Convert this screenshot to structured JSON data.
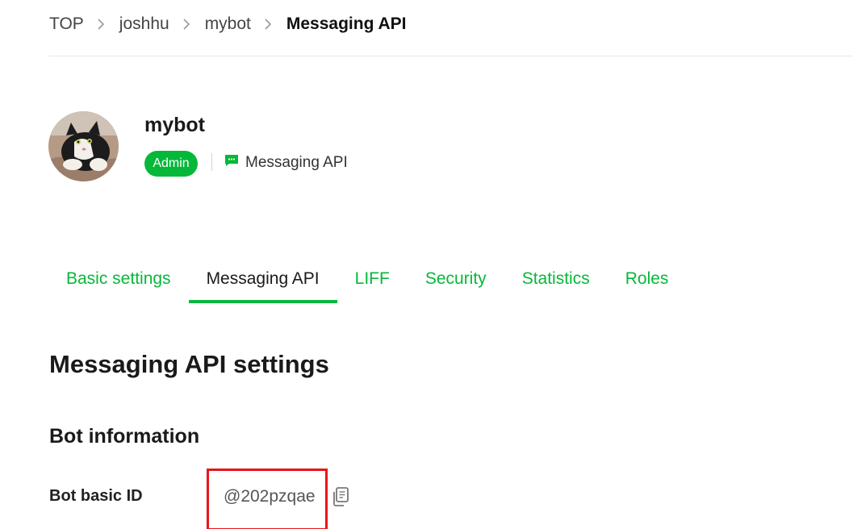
{
  "breadcrumb": {
    "items": [
      "TOP",
      "joshhu",
      "mybot"
    ],
    "current": "Messaging API"
  },
  "channel": {
    "name": "mybot",
    "role_badge": "Admin",
    "type": "Messaging API",
    "type_icon": "chat-bubble-icon"
  },
  "tabs": [
    {
      "label": "Basic settings",
      "active": false
    },
    {
      "label": "Messaging API",
      "active": true
    },
    {
      "label": "LIFF",
      "active": false
    },
    {
      "label": "Security",
      "active": false
    },
    {
      "label": "Statistics",
      "active": false
    },
    {
      "label": "Roles",
      "active": false
    }
  ],
  "content": {
    "section_title": "Messaging API settings",
    "subsection_title": "Bot information",
    "fields": [
      {
        "label": "Bot basic ID",
        "value": "@202pzqae"
      }
    ]
  },
  "colors": {
    "accent": "#06b83a",
    "highlight": "#e8141a"
  }
}
